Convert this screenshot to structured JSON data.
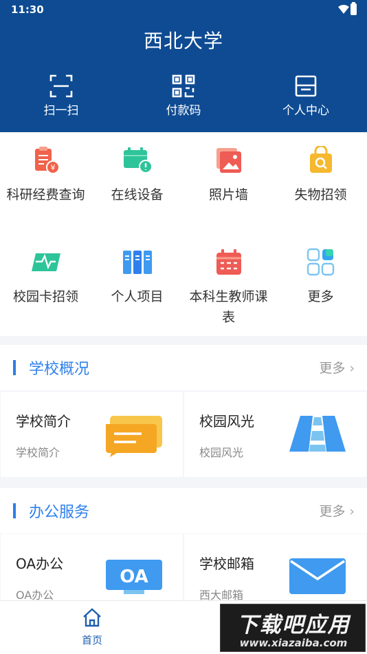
{
  "status_bar": {
    "time": "11:30"
  },
  "header": {
    "title": "西北大学"
  },
  "quick_actions": [
    {
      "label": "扫一扫",
      "icon": "scan-icon"
    },
    {
      "label": "付款码",
      "icon": "qr-code-icon"
    },
    {
      "label": "个人中心",
      "icon": "inbox-icon"
    }
  ],
  "grid": [
    {
      "label": "科研经费查询",
      "icon": "research-funds-icon",
      "color": "#f0624a"
    },
    {
      "label": "在线设备",
      "icon": "online-device-icon",
      "color": "#2ec49a"
    },
    {
      "label": "照片墙",
      "icon": "photo-wall-icon",
      "color": "#ef5b55"
    },
    {
      "label": "失物招领",
      "icon": "lost-found-bag-icon",
      "color": "#f5b82e"
    },
    {
      "label": "校园卡招领",
      "icon": "campus-card-icon",
      "color": "#2ec49a"
    },
    {
      "label": "个人项目",
      "icon": "personal-project-icon",
      "color": "#3f9af0"
    },
    {
      "label": "本科生教师课表",
      "icon": "timetable-icon",
      "color": "#ef5b55"
    },
    {
      "label": "更多",
      "icon": "more-apps-icon",
      "color": "#34a6f0"
    }
  ],
  "sections": [
    {
      "title": "学校概况",
      "more": "更多",
      "cards": [
        {
          "title": "学校简介",
          "subtitle": "学校简介",
          "icon": "chat-bubbles-icon"
        },
        {
          "title": "校园风光",
          "subtitle": "校园风光",
          "icon": "road-icon"
        }
      ]
    },
    {
      "title": "办公服务",
      "more": "更多",
      "cards": [
        {
          "title": "OA办公",
          "subtitle": "OA办公",
          "icon": "oa-monitor-icon",
          "icon_text": "OA"
        },
        {
          "title": "学校邮箱",
          "subtitle": "西大邮箱",
          "icon": "mail-icon"
        }
      ]
    }
  ],
  "tabbar": {
    "home_label": "首页"
  },
  "watermark": {
    "line1": "下载吧应用",
    "line2": "www.xiazaiba.com"
  },
  "colors": {
    "header_bg": "#0e4b93",
    "accent_blue": "#2f80ed"
  }
}
